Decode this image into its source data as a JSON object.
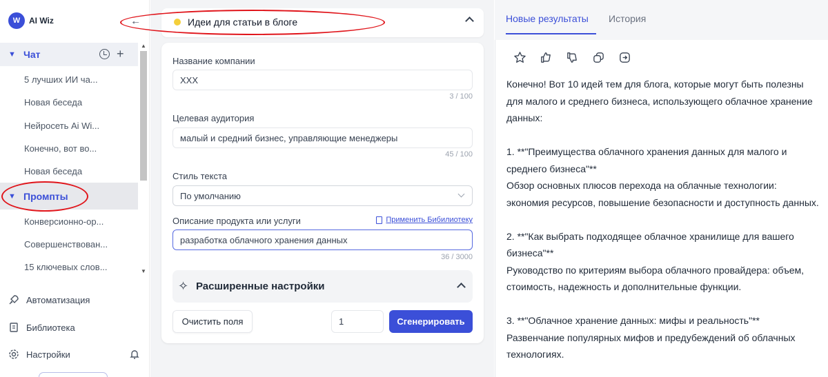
{
  "app": {
    "logo_mark": "W",
    "logo_name": "AI Wiz"
  },
  "sidebar": {
    "chat_label": "Чат",
    "chat_items": [
      "5 лучших ИИ ча...",
      "Новая беседа",
      "Нейросеть Ai Wi...",
      "Конечно, вот во...",
      "Новая беседа"
    ],
    "prompts_label": "Промпты",
    "prompt_items": [
      "Конверсионно-ор...",
      "Совершенствован...",
      "15 ключевых слов..."
    ],
    "nav": [
      {
        "label": "Автоматизация",
        "icon": "rocket-icon"
      },
      {
        "label": "Библиотека",
        "icon": "book-icon"
      },
      {
        "label": "Настройки",
        "icon": "gear-icon"
      }
    ]
  },
  "prompt_form": {
    "title": "Идеи для статьи в блоге",
    "company_label": "Название компании",
    "company_value": "XXX",
    "company_count": "3 / 100",
    "audience_label": "Целевая аудитория",
    "audience_value": "малый и средний бизнес, управляющие менеджеры",
    "audience_count": "45 / 100",
    "style_label": "Стиль текста",
    "style_value": "По умолчанию",
    "product_label": "Описание продукта или услуги",
    "library_link": "Применить Бибилиотеку",
    "product_value": "разработка облачного хранения данных",
    "product_count": "36 / 3000",
    "advanced_label": "Расширенные настройки",
    "clear_button": "Очистить поля",
    "quantity": "1",
    "generate_button": "Сгенерировать"
  },
  "results": {
    "tabs": [
      "Новые результаты",
      "История"
    ],
    "active_tab": 0,
    "action_icons": [
      "star-icon",
      "thumbs-up-icon",
      "thumbs-down-icon",
      "copy-icon",
      "export-icon"
    ],
    "text": "Конечно! Вот 10 идей тем для блога, которые могут быть полезны для малого и среднего бизнеса, использующего облачное хранение данных:\n\n1. **\"Преимущества облачного хранения данных для малого и среднего бизнеса\"**\nОбзор основных плюсов перехода на облачные технологии: экономия ресурсов, повышение безопасности и доступность данных.\n\n2. **\"Как выбрать подходящее облачное хранилище для вашего бизнеса\"**\nРуководство по критериям выбора облачного провайдера: объем, стоимость, надежность и дополнительные функции.\n\n3. **\"Облачное хранение данных: мифы и реальность\"**\nРазвенчание популярных мифов и предубеждений об облачных технологиях."
  },
  "colors": {
    "accent": "#3b4fd8",
    "annotation": "#e0151b"
  }
}
